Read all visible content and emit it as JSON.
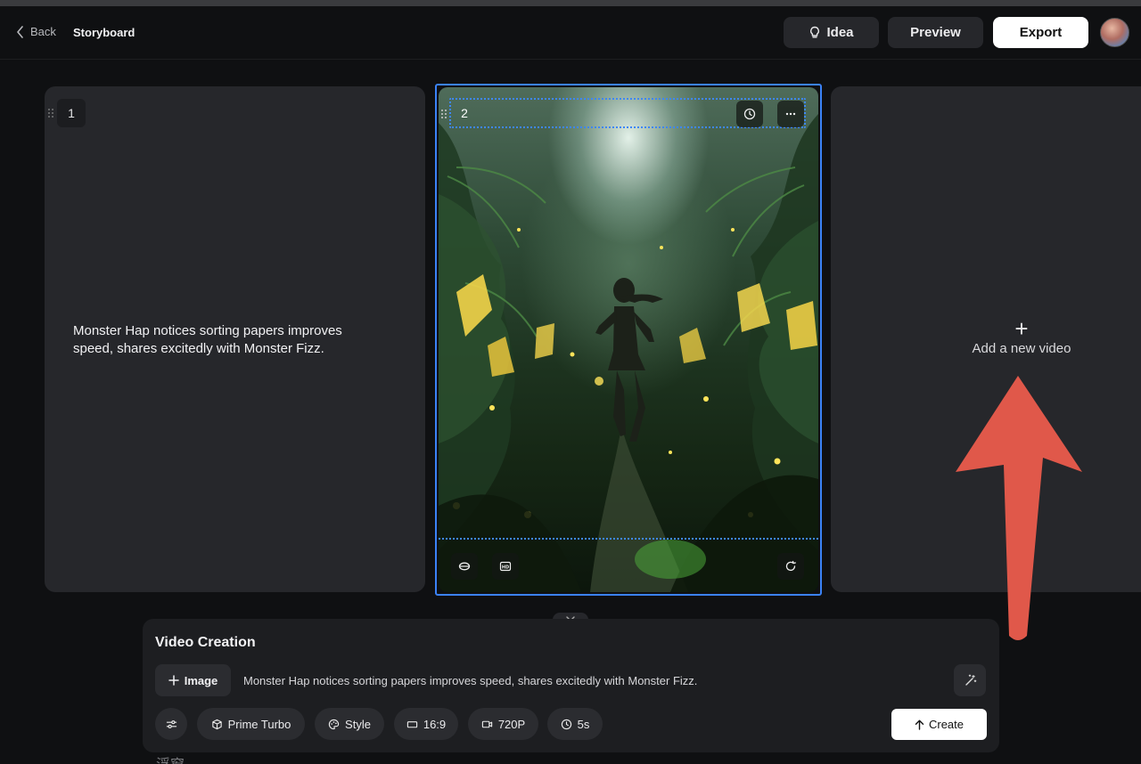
{
  "header": {
    "back_label": "Back",
    "breadcrumb": "Storyboard",
    "idea_label": "Idea",
    "preview_label": "Preview",
    "export_label": "Export"
  },
  "storyboard": {
    "cards": [
      {
        "number": "1",
        "text": "Monster Hap  notices sorting papers improves speed, shares excitedly with Monster Fizz."
      },
      {
        "number": "2"
      }
    ],
    "add_new_label": "Add a new video",
    "add_new_icon": "plus-icon"
  },
  "video_creation": {
    "title": "Video Creation",
    "image_button": "Image",
    "prompt": "Monster Hap  notices sorting papers improves speed, shares excitedly with Monster Fizz.",
    "model": "Prime Turbo",
    "style": "Style",
    "aspect_ratio": "16:9",
    "resolution": "720P",
    "duration": "5s",
    "create_label": "Create"
  },
  "floating_label": "浮窗",
  "colors": {
    "selection": "#3b82f6",
    "annotation_arrow": "#e0584a",
    "background": "#0f1012",
    "card": "#26272b"
  }
}
